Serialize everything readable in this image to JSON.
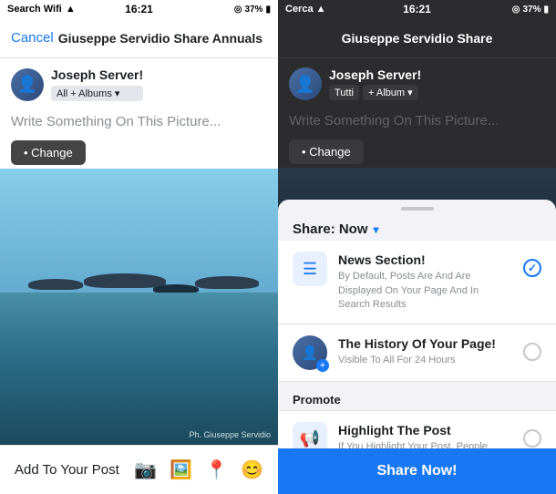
{
  "left": {
    "status_bar": {
      "carrier": "Search Wifi",
      "time": "16:21",
      "battery": "37%"
    },
    "nav": {
      "cancel": "Cancel",
      "title": "Giuseppe Servidio Share Annuals"
    },
    "user": {
      "name": "Joseph Server!",
      "audience": "All + Albums ▾"
    },
    "write_placeholder": "Write Something On This Picture...",
    "change_btn": "• Change",
    "photo_credit": "Ph. Giuseppe Servidio",
    "add_to_post": "Add To Your Post"
  },
  "right": {
    "status_bar": {
      "carrier": "Cerca",
      "time": "16:21",
      "battery": "37%"
    },
    "nav": {
      "title": "Giuseppe Servidio Share"
    },
    "user": {
      "name": "Joseph Server!",
      "audience_1": "Tutti",
      "audience_2": "+ Album ▾"
    },
    "write_placeholder": "Write Something On This Picture...",
    "change_btn": "• Change",
    "share_sheet": {
      "title": "Share: Now",
      "dropdown_icon": "▾",
      "options": [
        {
          "id": "news",
          "title": "News Section!",
          "desc": "By Default, Posts Are And Are Displayed On Your Page And In Search Results",
          "selected": true
        },
        {
          "id": "history",
          "title": "The History Of Your Page!",
          "desc": "Visible To All For 24 Hours",
          "selected": false
        }
      ],
      "promote_label": "Promote",
      "highlight": {
        "title": "Highlight The Post",
        "desc": "If You Highlight Your Post, People Page And They Can See It And Interact With You."
      },
      "share_btn": "Share Now!"
    }
  }
}
